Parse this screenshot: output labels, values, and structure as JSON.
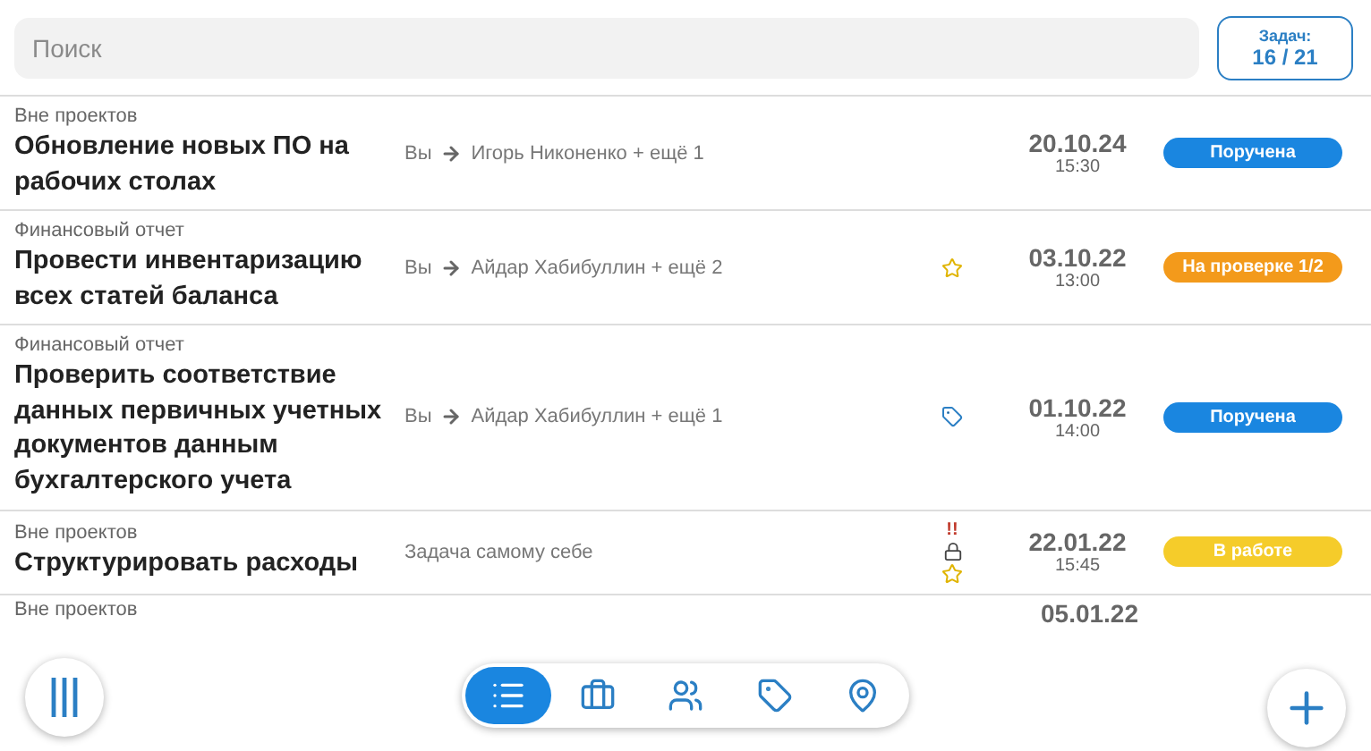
{
  "search": {
    "placeholder": "Поиск"
  },
  "counter": {
    "label": "Задач:",
    "value": "16 / 21"
  },
  "tasks": [
    {
      "project": "Вне проектов",
      "title": "Обновление новых ПО на рабочих столах",
      "from": "Вы",
      "to": "Игорь Никоненко + ещё 1",
      "date": "20.10.24",
      "time": "15:30",
      "status": "Поручена",
      "color": "#1a86e0"
    },
    {
      "project": "Финансовый отчет",
      "title": "Провести инвентаризацию всех статей баланса",
      "from": "Вы",
      "to": "Айдар Хабибуллин + ещё 2",
      "marks": [
        {
          "kind": "star"
        }
      ],
      "date": "03.10.22",
      "time": "13:00",
      "status": "На проверке 1/2",
      "color": "#f39a1b"
    },
    {
      "project": "Финансовый отчет",
      "title": "Проверить соответствие данных первичных учетных документов данным бухгалтерского учета",
      "from": "Вы",
      "to": "Айдар Хабибуллин + ещё 1",
      "marks": [
        {
          "kind": "tag"
        }
      ],
      "date": "01.10.22",
      "time": "14:00",
      "status": "Поручена",
      "color": "#1a86e0"
    },
    {
      "project": "Вне проектов",
      "title": "Структурировать расходы",
      "to": "Задача самому себе",
      "marks": [
        {
          "kind": "priority",
          "text": "!!"
        },
        {
          "kind": "lock"
        },
        {
          "kind": "star"
        }
      ],
      "date": "22.01.22",
      "time": "15:45",
      "status": "В работе",
      "color": "#f5cc2a"
    },
    {
      "project": "Вне проектов",
      "date": "05.01.22"
    }
  ],
  "nav": [
    {
      "kind": "list",
      "selected": true
    },
    {
      "kind": "briefcase",
      "selected": false
    },
    {
      "kind": "users",
      "selected": false
    },
    {
      "kind": "tag",
      "selected": false
    },
    {
      "kind": "pin",
      "selected": false
    }
  ]
}
